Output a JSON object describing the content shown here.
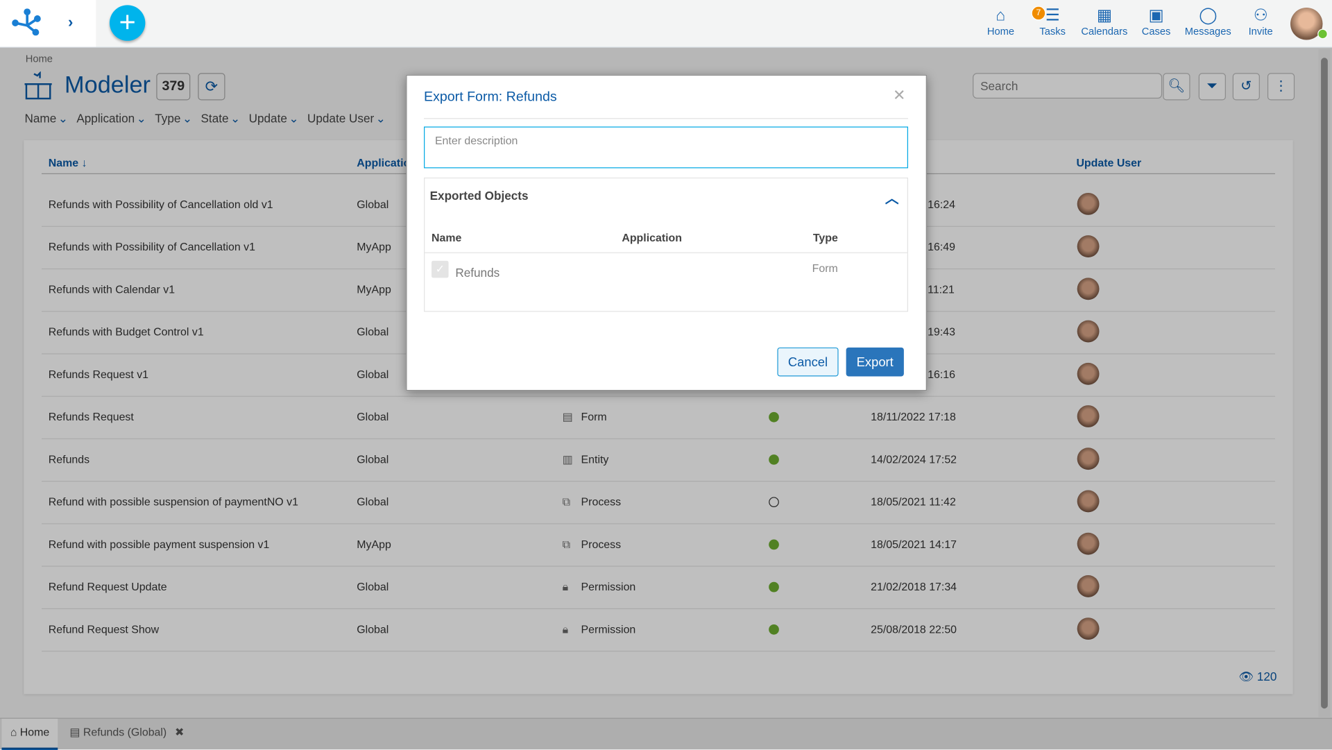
{
  "topbar": {
    "nav": [
      {
        "label": "Home",
        "icon": "home-icon"
      },
      {
        "label": "Tasks",
        "icon": "tasks-icon",
        "badge": "7"
      },
      {
        "label": "Calendars",
        "icon": "calendar-icon"
      },
      {
        "label": "Cases",
        "icon": "briefcase-icon"
      },
      {
        "label": "Messages",
        "icon": "message-icon"
      },
      {
        "label": "Invite",
        "icon": "invite-icon"
      }
    ]
  },
  "breadcrumb": "Home",
  "page": {
    "title": "Modeler",
    "count": "379",
    "search_placeholder": "Search",
    "filters": [
      "Name",
      "Application",
      "Type",
      "State",
      "Update",
      "Update User"
    ]
  },
  "table": {
    "headers": {
      "name": "Name",
      "application": "Applicatio",
      "update_user": "Update User"
    },
    "rows": [
      {
        "name": "Refunds with Possibility of Cancellation old v1",
        "app": "Global",
        "type": "",
        "state": "",
        "update": "16:24"
      },
      {
        "name": "Refunds with Possibility of Cancellation v1",
        "app": "MyApp",
        "type": "",
        "state": "",
        "update": "16:49"
      },
      {
        "name": "Refunds with Calendar v1",
        "app": "MyApp",
        "type": "",
        "state": "",
        "update": "11:21"
      },
      {
        "name": "Refunds with Budget Control v1",
        "app": "Global",
        "type": "",
        "state": "",
        "update": "19:43"
      },
      {
        "name": "Refunds Request v1",
        "app": "Global",
        "type": "",
        "state": "",
        "update": "16:16"
      },
      {
        "name": "Refunds Request",
        "app": "Global",
        "type": "Form",
        "state": "active",
        "update": "18/11/2022 17:18"
      },
      {
        "name": "Refunds",
        "app": "Global",
        "type": "Entity",
        "state": "active",
        "update": "14/02/2024 17:52"
      },
      {
        "name": "Refund with possible suspension of paymentNO v1",
        "app": "Global",
        "type": "Process",
        "state": "inactive",
        "update": "18/05/2021 11:42"
      },
      {
        "name": "Refund with possible payment suspension v1",
        "app": "MyApp",
        "type": "Process",
        "state": "active",
        "update": "18/05/2021 14:17"
      },
      {
        "name": "Refund Request Update",
        "app": "Global",
        "type": "Permission",
        "state": "active",
        "update": "21/02/2018 17:34"
      },
      {
        "name": "Refund Request Show",
        "app": "Global",
        "type": "Permission",
        "state": "active",
        "update": "25/08/2018 22:50"
      }
    ],
    "views": "120"
  },
  "tabs": [
    {
      "label": "Home"
    },
    {
      "label": "Refunds (Global)"
    }
  ],
  "modal": {
    "title": "Export Form: Refunds",
    "description_placeholder": "Enter description",
    "panel_title": "Exported Objects",
    "headers": {
      "name": "Name",
      "application": "Application",
      "type": "Type"
    },
    "item": {
      "name": "Refunds",
      "application": "",
      "type": "Form",
      "checked": true
    },
    "cancel": "Cancel",
    "export": "Export"
  },
  "colors": {
    "accent": "#0b5aa6",
    "plus": "#00b4ec",
    "badge": "#f08c00",
    "active_state": "#6dac2f"
  }
}
